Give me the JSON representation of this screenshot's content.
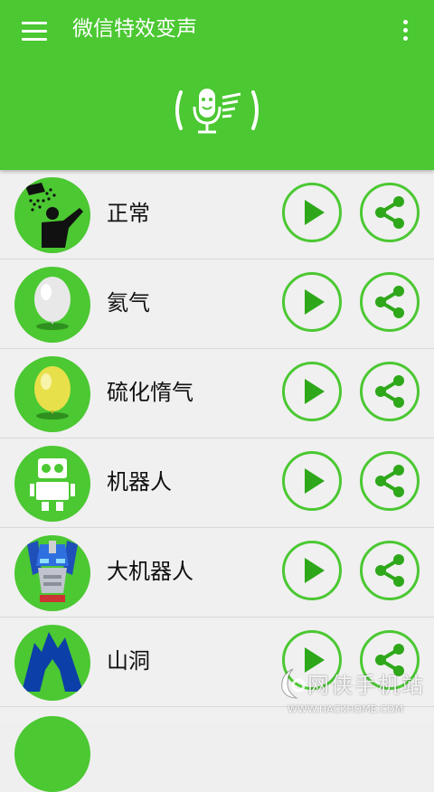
{
  "header": {
    "title": "微信特效变声",
    "menu_icon": "hamburger-menu-icon",
    "overflow_icon": "more-vert-icon",
    "mic_icon": "microphone-icon",
    "background_color": "#4bc832"
  },
  "effects": [
    {
      "label": "正常",
      "icon": "shower-person-icon"
    },
    {
      "label": "氦气",
      "icon": "white-balloon-icon"
    },
    {
      "label": "硫化惰气",
      "icon": "yellow-balloon-icon"
    },
    {
      "label": "机器人",
      "icon": "robot-icon"
    },
    {
      "label": "大机器人",
      "icon": "big-robot-icon"
    },
    {
      "label": "山洞",
      "icon": "cave-icon"
    }
  ],
  "actions": {
    "play_icon": "play-icon",
    "share_icon": "share-icon"
  },
  "watermark": {
    "text": "网侠手机站",
    "url": "WWW.HACKHOME.COM"
  }
}
